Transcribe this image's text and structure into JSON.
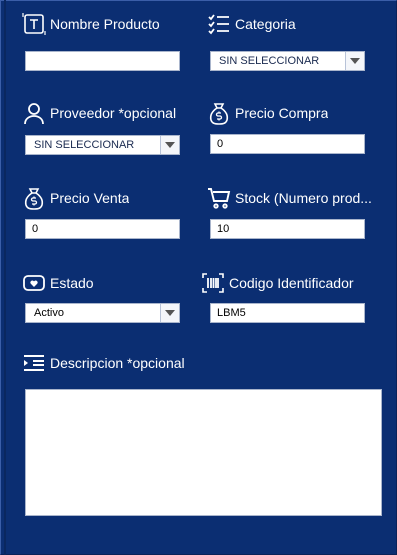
{
  "fields": {
    "nombre": {
      "label": "Nombre Producto",
      "value": "",
      "icon": "text-field-icon"
    },
    "categoria": {
      "label": "Categoria",
      "value": "SIN SELECCIONAR",
      "icon": "checklist-icon"
    },
    "proveedor": {
      "label": "Proveedor *opcional",
      "value": "SIN SELECCIONAR",
      "icon": "person-icon"
    },
    "precio_compra": {
      "label": "Precio Compra",
      "value": "0",
      "icon": "money-bag-icon"
    },
    "precio_venta": {
      "label": "Precio Venta",
      "value": "0",
      "icon": "money-bag-icon"
    },
    "stock": {
      "label": "Stock (Numero prod...",
      "value": "10",
      "icon": "cart-icon"
    },
    "estado": {
      "label": "Estado",
      "value": "Activo",
      "icon": "heart-tag-icon"
    },
    "codigo": {
      "label": "Codigo Identificador",
      "value": "LBM5",
      "icon": "barcode-icon"
    },
    "descripcion": {
      "label": "Descripcion *opcional",
      "value": "",
      "icon": "list-indent-icon"
    }
  },
  "colors": {
    "background": "#0b2e72",
    "text": "#ffffff"
  }
}
